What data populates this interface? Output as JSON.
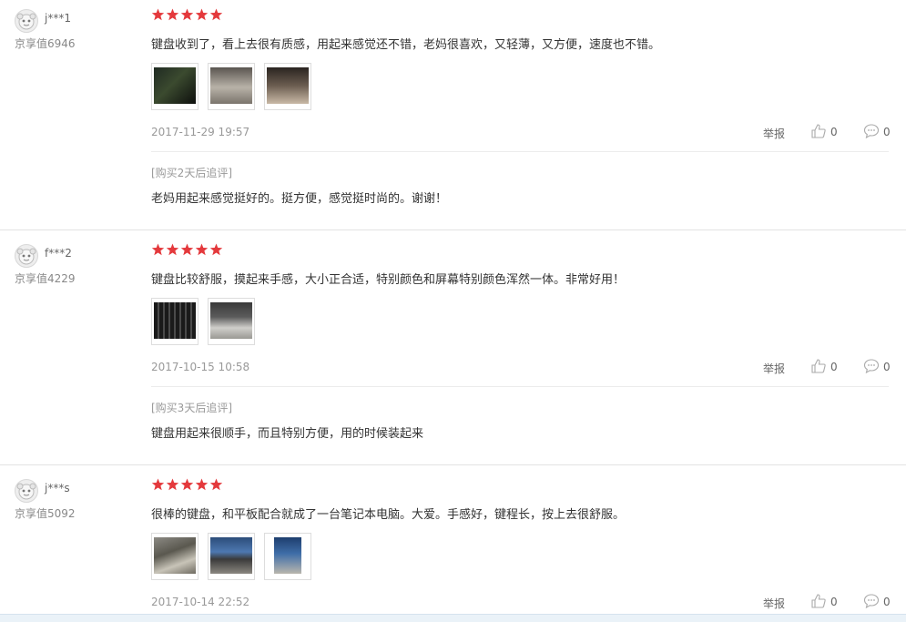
{
  "reviews": [
    {
      "username": "j***1",
      "score_label": "京享值6946",
      "rating": 5,
      "content": "键盘收到了，看上去很有质感，用起来感觉还不错，老妈很喜欢，又轻薄，又方便，速度也不错。",
      "date": "2017-11-29 19:57",
      "report_label": "举报",
      "likes": "0",
      "replies": "0",
      "append_label": "[购买2天后追评]",
      "append_content": "老妈用起来感觉挺好的。挺方便，感觉挺时尚的。谢谢！"
    },
    {
      "username": "f***2",
      "score_label": "京享值4229",
      "rating": 5,
      "content": "键盘比较舒服，摸起来手感，大小正合适，特别颜色和屏幕特别颜色浑然一体。非常好用！",
      "date": "2017-10-15 10:58",
      "report_label": "举报",
      "likes": "0",
      "replies": "0",
      "append_label": "[购买3天后追评]",
      "append_content": "键盘用起来很顺手，而且特别方便，用的时候装起来"
    },
    {
      "username": "j***s",
      "score_label": "京享值5092",
      "rating": 5,
      "content": "很棒的键盘，和平板配合就成了一台笔记本电脑。大爱。手感好，键程长，按上去很舒服。",
      "date": "2017-10-14 22:52",
      "report_label": "举报",
      "likes": "0",
      "replies": "0"
    }
  ],
  "colors": {
    "star": "#e4393c",
    "text": "#333333",
    "muted": "#999999"
  },
  "icons": {
    "star": "star-icon",
    "like": "thumbs-up-icon",
    "reply": "comment-bubble-icon",
    "avatar": "user-avatar-icon"
  }
}
